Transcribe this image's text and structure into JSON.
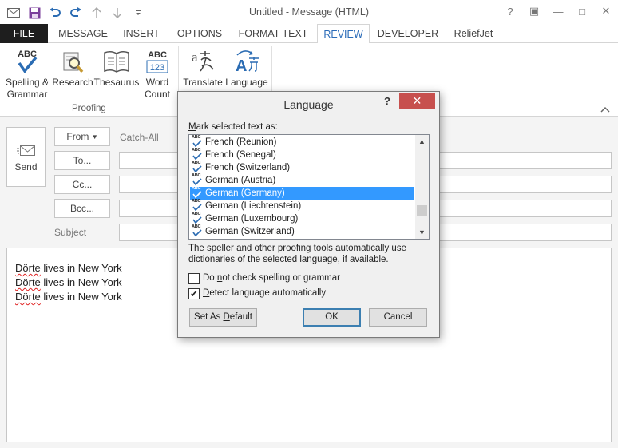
{
  "window": {
    "title": "Untitled - Message (HTML)",
    "controls": {
      "help": "?",
      "restore": "▣",
      "minimize": "—",
      "maximize": "□",
      "close": "✕"
    }
  },
  "quick_access": [
    "save-icon",
    "undo-icon",
    "redo-icon",
    "up-icon",
    "down-icon",
    "customize-icon"
  ],
  "tabs": [
    {
      "label": "FILE"
    },
    {
      "label": "MESSAGE"
    },
    {
      "label": "INSERT"
    },
    {
      "label": "OPTIONS"
    },
    {
      "label": "FORMAT TEXT"
    },
    {
      "label": "REVIEW",
      "active": true
    },
    {
      "label": "DEVELOPER"
    },
    {
      "label": "ReliefJet"
    }
  ],
  "ribbon": {
    "proofing": {
      "group_label": "Proofing",
      "spelling": {
        "line1": "Spelling &",
        "line2": "Grammar",
        "icon_text": "ABC"
      },
      "research": {
        "label": "Research"
      },
      "thesaurus": {
        "label": "Thesaurus"
      },
      "word_count": {
        "line1": "Word",
        "line2": "Count",
        "icon_text": "ABC",
        "icon_num": "123"
      }
    },
    "language_group": {
      "translate": {
        "label": "Translate"
      },
      "language": {
        "label": "Language"
      }
    }
  },
  "compose": {
    "send_label": "Send",
    "from_label": "From",
    "from_value": "Catch-All",
    "to_label": "To...",
    "cc_label": "Cc...",
    "bcc_label": "Bcc...",
    "subject_label": "Subject",
    "body_lines": [
      {
        "name": "Dörte",
        "rest": " lives in New York"
      },
      {
        "name": "Dörte",
        "rest": " lives in New York"
      },
      {
        "name": "Dörte",
        "rest": " lives in New York"
      }
    ]
  },
  "dialog": {
    "title": "Language",
    "help": "?",
    "close": "✕",
    "mark_label_ul": "M",
    "mark_label_rest": "ark selected text as:",
    "languages": [
      {
        "label": "French (Reunion)",
        "selected": false
      },
      {
        "label": "French (Senegal)",
        "selected": false
      },
      {
        "label": "French (Switzerland)",
        "selected": false
      },
      {
        "label": "German (Austria)",
        "selected": false
      },
      {
        "label": "German (Germany)",
        "selected": true
      },
      {
        "label": "German (Liechtenstein)",
        "selected": false
      },
      {
        "label": "German (Luxembourg)",
        "selected": false
      },
      {
        "label": "German (Switzerland)",
        "selected": false
      }
    ],
    "spell_icon_text": "ABC",
    "description": "The speller and other proofing tools automatically use dictionaries of the selected language, if available.",
    "do_not_check": {
      "pre": "Do ",
      "ul": "n",
      "post": "ot check spelling or grammar",
      "checked": false
    },
    "detect": {
      "pre": "",
      "ul": "D",
      "post": "etect language automatically",
      "checked": true
    },
    "buttons": {
      "set_default_pre": "Set As ",
      "set_default_ul": "D",
      "set_default_post": "efault",
      "ok": "OK",
      "cancel": "Cancel"
    }
  }
}
